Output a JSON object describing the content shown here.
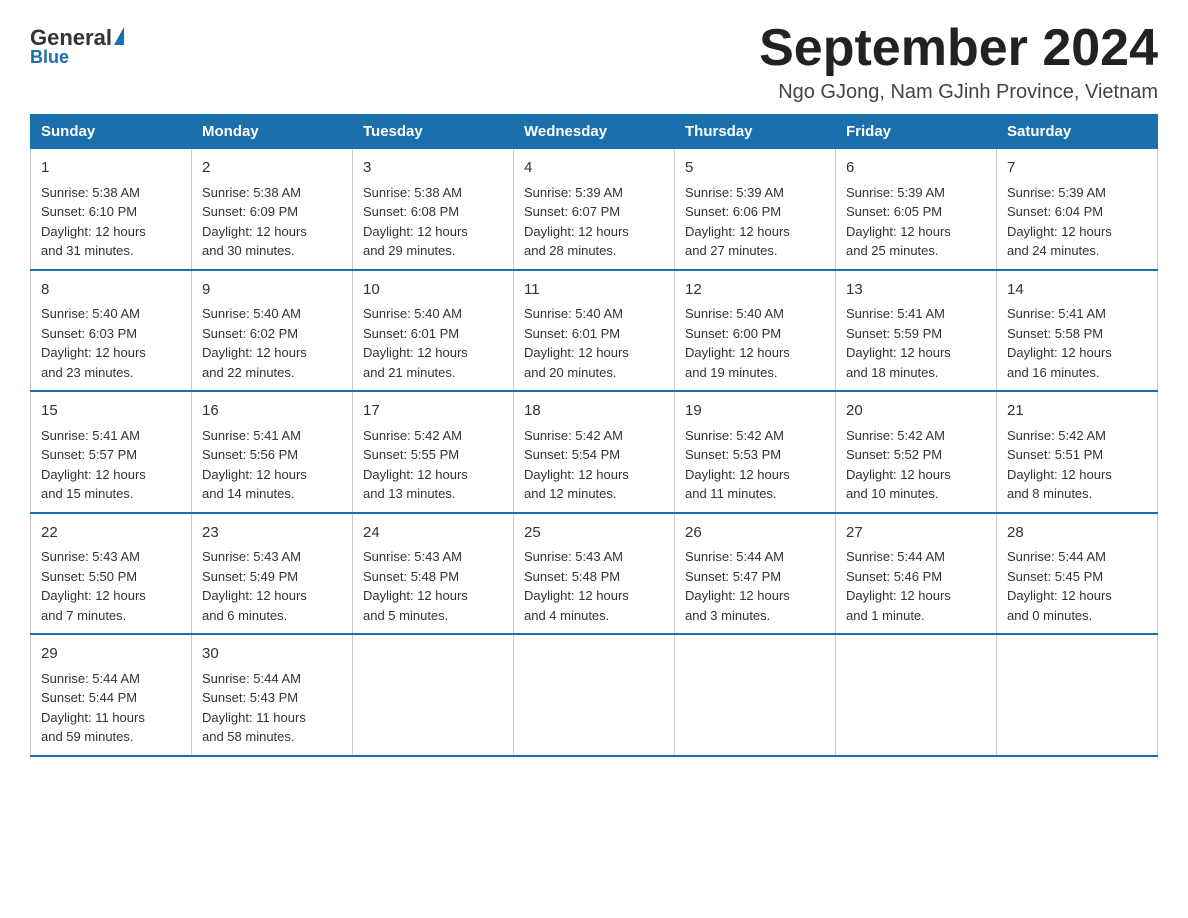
{
  "logo": {
    "general": "General",
    "blue": "Blue",
    "tagline": "Blue"
  },
  "header": {
    "month_year": "September 2024",
    "location": "Ngo GJong, Nam GJinh Province, Vietnam"
  },
  "days_of_week": [
    "Sunday",
    "Monday",
    "Tuesday",
    "Wednesday",
    "Thursday",
    "Friday",
    "Saturday"
  ],
  "weeks": [
    [
      {
        "day": "1",
        "sunrise": "5:38 AM",
        "sunset": "6:10 PM",
        "daylight": "12 hours and 31 minutes."
      },
      {
        "day": "2",
        "sunrise": "5:38 AM",
        "sunset": "6:09 PM",
        "daylight": "12 hours and 30 minutes."
      },
      {
        "day": "3",
        "sunrise": "5:38 AM",
        "sunset": "6:08 PM",
        "daylight": "12 hours and 29 minutes."
      },
      {
        "day": "4",
        "sunrise": "5:39 AM",
        "sunset": "6:07 PM",
        "daylight": "12 hours and 28 minutes."
      },
      {
        "day": "5",
        "sunrise": "5:39 AM",
        "sunset": "6:06 PM",
        "daylight": "12 hours and 27 minutes."
      },
      {
        "day": "6",
        "sunrise": "5:39 AM",
        "sunset": "6:05 PM",
        "daylight": "12 hours and 25 minutes."
      },
      {
        "day": "7",
        "sunrise": "5:39 AM",
        "sunset": "6:04 PM",
        "daylight": "12 hours and 24 minutes."
      }
    ],
    [
      {
        "day": "8",
        "sunrise": "5:40 AM",
        "sunset": "6:03 PM",
        "daylight": "12 hours and 23 minutes."
      },
      {
        "day": "9",
        "sunrise": "5:40 AM",
        "sunset": "6:02 PM",
        "daylight": "12 hours and 22 minutes."
      },
      {
        "day": "10",
        "sunrise": "5:40 AM",
        "sunset": "6:01 PM",
        "daylight": "12 hours and 21 minutes."
      },
      {
        "day": "11",
        "sunrise": "5:40 AM",
        "sunset": "6:01 PM",
        "daylight": "12 hours and 20 minutes."
      },
      {
        "day": "12",
        "sunrise": "5:40 AM",
        "sunset": "6:00 PM",
        "daylight": "12 hours and 19 minutes."
      },
      {
        "day": "13",
        "sunrise": "5:41 AM",
        "sunset": "5:59 PM",
        "daylight": "12 hours and 18 minutes."
      },
      {
        "day": "14",
        "sunrise": "5:41 AM",
        "sunset": "5:58 PM",
        "daylight": "12 hours and 16 minutes."
      }
    ],
    [
      {
        "day": "15",
        "sunrise": "5:41 AM",
        "sunset": "5:57 PM",
        "daylight": "12 hours and 15 minutes."
      },
      {
        "day": "16",
        "sunrise": "5:41 AM",
        "sunset": "5:56 PM",
        "daylight": "12 hours and 14 minutes."
      },
      {
        "day": "17",
        "sunrise": "5:42 AM",
        "sunset": "5:55 PM",
        "daylight": "12 hours and 13 minutes."
      },
      {
        "day": "18",
        "sunrise": "5:42 AM",
        "sunset": "5:54 PM",
        "daylight": "12 hours and 12 minutes."
      },
      {
        "day": "19",
        "sunrise": "5:42 AM",
        "sunset": "5:53 PM",
        "daylight": "12 hours and 11 minutes."
      },
      {
        "day": "20",
        "sunrise": "5:42 AM",
        "sunset": "5:52 PM",
        "daylight": "12 hours and 10 minutes."
      },
      {
        "day": "21",
        "sunrise": "5:42 AM",
        "sunset": "5:51 PM",
        "daylight": "12 hours and 8 minutes."
      }
    ],
    [
      {
        "day": "22",
        "sunrise": "5:43 AM",
        "sunset": "5:50 PM",
        "daylight": "12 hours and 7 minutes."
      },
      {
        "day": "23",
        "sunrise": "5:43 AM",
        "sunset": "5:49 PM",
        "daylight": "12 hours and 6 minutes."
      },
      {
        "day": "24",
        "sunrise": "5:43 AM",
        "sunset": "5:48 PM",
        "daylight": "12 hours and 5 minutes."
      },
      {
        "day": "25",
        "sunrise": "5:43 AM",
        "sunset": "5:48 PM",
        "daylight": "12 hours and 4 minutes."
      },
      {
        "day": "26",
        "sunrise": "5:44 AM",
        "sunset": "5:47 PM",
        "daylight": "12 hours and 3 minutes."
      },
      {
        "day": "27",
        "sunrise": "5:44 AM",
        "sunset": "5:46 PM",
        "daylight": "12 hours and 1 minute."
      },
      {
        "day": "28",
        "sunrise": "5:44 AM",
        "sunset": "5:45 PM",
        "daylight": "12 hours and 0 minutes."
      }
    ],
    [
      {
        "day": "29",
        "sunrise": "5:44 AM",
        "sunset": "5:44 PM",
        "daylight": "11 hours and 59 minutes."
      },
      {
        "day": "30",
        "sunrise": "5:44 AM",
        "sunset": "5:43 PM",
        "daylight": "11 hours and 58 minutes."
      },
      null,
      null,
      null,
      null,
      null
    ]
  ]
}
